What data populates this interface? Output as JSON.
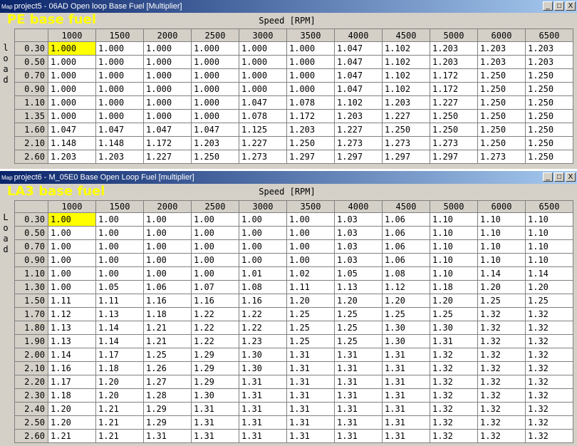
{
  "windows": [
    {
      "icon": "Map",
      "title": "project5 - 06AD Open loop Base Fuel  [Multiplier]",
      "overlay_label": "PE base fuel",
      "x_axis_label": "Speed [RPM]",
      "y_axis_label": "load",
      "buttons": [
        "_",
        "□",
        "X"
      ],
      "columns": [
        "1000",
        "1500",
        "2000",
        "2500",
        "3000",
        "3500",
        "4000",
        "4500",
        "5000",
        "6000",
        "6500"
      ],
      "rows": [
        {
          "label": "0.30",
          "values": [
            "1.000",
            "1.000",
            "1.000",
            "1.000",
            "1.000",
            "1.000",
            "1.047",
            "1.102",
            "1.203",
            "1.203",
            "1.203"
          ]
        },
        {
          "label": "0.50",
          "values": [
            "1.000",
            "1.000",
            "1.000",
            "1.000",
            "1.000",
            "1.000",
            "1.047",
            "1.102",
            "1.203",
            "1.203",
            "1.203"
          ]
        },
        {
          "label": "0.70",
          "values": [
            "1.000",
            "1.000",
            "1.000",
            "1.000",
            "1.000",
            "1.000",
            "1.047",
            "1.102",
            "1.172",
            "1.250",
            "1.250"
          ]
        },
        {
          "label": "0.90",
          "values": [
            "1.000",
            "1.000",
            "1.000",
            "1.000",
            "1.000",
            "1.000",
            "1.047",
            "1.102",
            "1.172",
            "1.250",
            "1.250"
          ]
        },
        {
          "label": "1.10",
          "values": [
            "1.000",
            "1.000",
            "1.000",
            "1.000",
            "1.047",
            "1.078",
            "1.102",
            "1.203",
            "1.227",
            "1.250",
            "1.250"
          ]
        },
        {
          "label": "1.35",
          "values": [
            "1.000",
            "1.000",
            "1.000",
            "1.000",
            "1.078",
            "1.172",
            "1.203",
            "1.227",
            "1.250",
            "1.250",
            "1.250"
          ]
        },
        {
          "label": "1.60",
          "values": [
            "1.047",
            "1.047",
            "1.047",
            "1.047",
            "1.125",
            "1.203",
            "1.227",
            "1.250",
            "1.250",
            "1.250",
            "1.250"
          ]
        },
        {
          "label": "2.10",
          "values": [
            "1.148",
            "1.148",
            "1.172",
            "1.203",
            "1.227",
            "1.250",
            "1.273",
            "1.273",
            "1.273",
            "1.250",
            "1.250"
          ]
        },
        {
          "label": "2.60",
          "values": [
            "1.203",
            "1.203",
            "1.227",
            "1.250",
            "1.273",
            "1.297",
            "1.297",
            "1.297",
            "1.297",
            "1.273",
            "1.250"
          ]
        }
      ]
    },
    {
      "icon": "Map",
      "title": "project6 - M_05E0 Base Open Loop Fuel [multiplier]",
      "overlay_label": "LA3 base fuel",
      "x_axis_label": "Speed [RPM]",
      "y_axis_label": "Load",
      "buttons": [
        "_",
        "□",
        "X"
      ],
      "columns": [
        "1000",
        "1500",
        "2000",
        "2500",
        "3000",
        "3500",
        "4000",
        "4500",
        "5000",
        "6000",
        "6500"
      ],
      "rows": [
        {
          "label": "0.30",
          "values": [
            "1.00",
            "1.00",
            "1.00",
            "1.00",
            "1.00",
            "1.00",
            "1.03",
            "1.06",
            "1.10",
            "1.10",
            "1.10"
          ]
        },
        {
          "label": "0.50",
          "values": [
            "1.00",
            "1.00",
            "1.00",
            "1.00",
            "1.00",
            "1.00",
            "1.03",
            "1.06",
            "1.10",
            "1.10",
            "1.10"
          ]
        },
        {
          "label": "0.70",
          "values": [
            "1.00",
            "1.00",
            "1.00",
            "1.00",
            "1.00",
            "1.00",
            "1.03",
            "1.06",
            "1.10",
            "1.10",
            "1.10"
          ]
        },
        {
          "label": "0.90",
          "values": [
            "1.00",
            "1.00",
            "1.00",
            "1.00",
            "1.00",
            "1.00",
            "1.03",
            "1.06",
            "1.10",
            "1.10",
            "1.10"
          ]
        },
        {
          "label": "1.10",
          "values": [
            "1.00",
            "1.00",
            "1.00",
            "1.00",
            "1.01",
            "1.02",
            "1.05",
            "1.08",
            "1.10",
            "1.14",
            "1.14"
          ]
        },
        {
          "label": "1.30",
          "values": [
            "1.00",
            "1.05",
            "1.06",
            "1.07",
            "1.08",
            "1.11",
            "1.13",
            "1.12",
            "1.18",
            "1.20",
            "1.20"
          ]
        },
        {
          "label": "1.50",
          "values": [
            "1.11",
            "1.11",
            "1.16",
            "1.16",
            "1.16",
            "1.20",
            "1.20",
            "1.20",
            "1.20",
            "1.25",
            "1.25"
          ]
        },
        {
          "label": "1.70",
          "values": [
            "1.12",
            "1.13",
            "1.18",
            "1.22",
            "1.22",
            "1.25",
            "1.25",
            "1.25",
            "1.25",
            "1.32",
            "1.32"
          ]
        },
        {
          "label": "1.80",
          "values": [
            "1.13",
            "1.14",
            "1.21",
            "1.22",
            "1.22",
            "1.25",
            "1.25",
            "1.30",
            "1.30",
            "1.32",
            "1.32"
          ]
        },
        {
          "label": "1.90",
          "values": [
            "1.13",
            "1.14",
            "1.21",
            "1.22",
            "1.23",
            "1.25",
            "1.25",
            "1.30",
            "1.31",
            "1.32",
            "1.32"
          ]
        },
        {
          "label": "2.00",
          "values": [
            "1.14",
            "1.17",
            "1.25",
            "1.29",
            "1.30",
            "1.31",
            "1.31",
            "1.31",
            "1.32",
            "1.32",
            "1.32"
          ]
        },
        {
          "label": "2.10",
          "values": [
            "1.16",
            "1.18",
            "1.26",
            "1.29",
            "1.30",
            "1.31",
            "1.31",
            "1.31",
            "1.32",
            "1.32",
            "1.32"
          ]
        },
        {
          "label": "2.20",
          "values": [
            "1.17",
            "1.20",
            "1.27",
            "1.29",
            "1.31",
            "1.31",
            "1.31",
            "1.31",
            "1.32",
            "1.32",
            "1.32"
          ]
        },
        {
          "label": "2.30",
          "values": [
            "1.18",
            "1.20",
            "1.28",
            "1.30",
            "1.31",
            "1.31",
            "1.31",
            "1.31",
            "1.32",
            "1.32",
            "1.32"
          ]
        },
        {
          "label": "2.40",
          "values": [
            "1.20",
            "1.21",
            "1.29",
            "1.31",
            "1.31",
            "1.31",
            "1.31",
            "1.31",
            "1.32",
            "1.32",
            "1.32"
          ]
        },
        {
          "label": "2.50",
          "values": [
            "1.20",
            "1.21",
            "1.29",
            "1.31",
            "1.31",
            "1.31",
            "1.31",
            "1.31",
            "1.32",
            "1.32",
            "1.32"
          ]
        },
        {
          "label": "2.60",
          "values": [
            "1.21",
            "1.21",
            "1.31",
            "1.31",
            "1.31",
            "1.31",
            "1.31",
            "1.31",
            "1.32",
            "1.32",
            "1.32"
          ]
        }
      ]
    }
  ]
}
